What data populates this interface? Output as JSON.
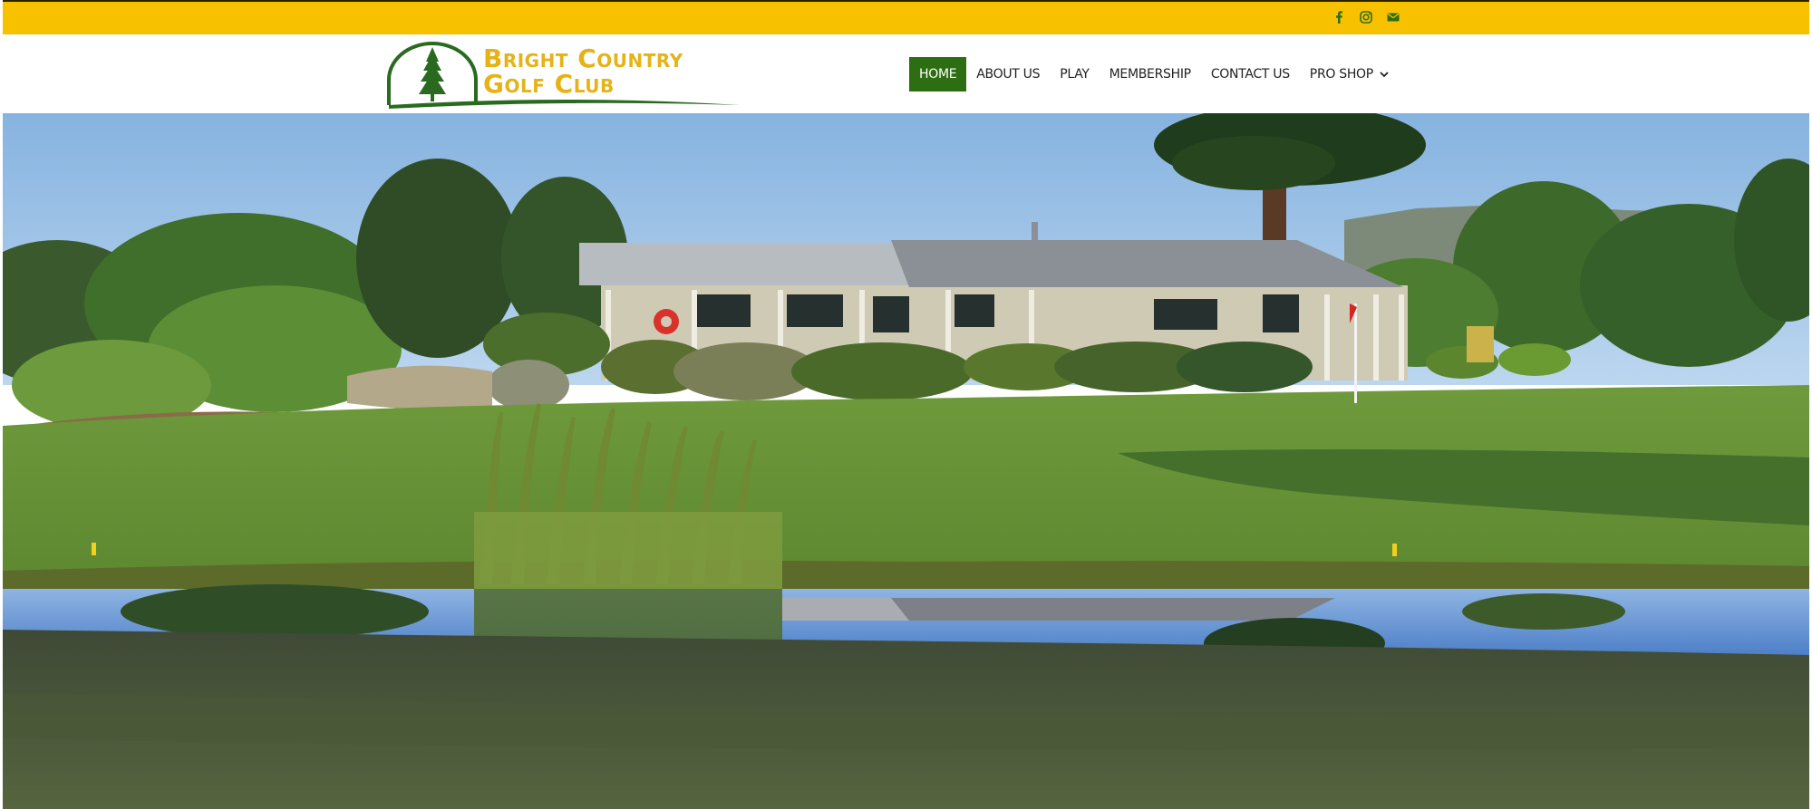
{
  "topbar": {
    "social": [
      {
        "icon": "facebook-icon",
        "label": "Facebook"
      },
      {
        "icon": "instagram-icon",
        "label": "Instagram"
      },
      {
        "icon": "email-icon",
        "label": "Email"
      }
    ]
  },
  "header": {
    "logo": {
      "line1": "Bright Country",
      "line2": "Golf Club"
    },
    "nav": [
      {
        "label": "HOME",
        "active": true
      },
      {
        "label": "ABOUT US",
        "active": false
      },
      {
        "label": "PLAY",
        "active": false
      },
      {
        "label": "MEMBERSHIP",
        "active": false
      },
      {
        "label": "CONTACT US",
        "active": false
      },
      {
        "label": "PRO SHOP",
        "active": false,
        "has_dropdown": true
      }
    ]
  },
  "hero": {
    "image": "clubhouse-photo"
  },
  "colors": {
    "topbar": "#f8c100",
    "nav_active": "#2e6e12",
    "logo_text": "#e5b316",
    "logo_green": "#2a6a20"
  }
}
